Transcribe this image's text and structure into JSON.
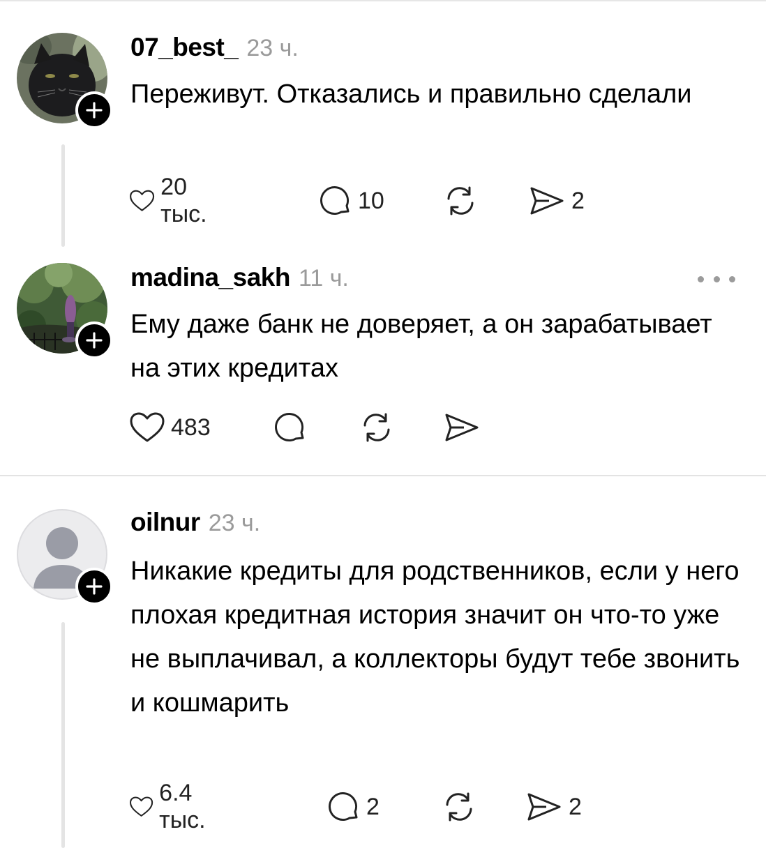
{
  "posts": [
    {
      "username": "07_best_",
      "time": "23 ч.",
      "text": "Переживут. Отказались и правильно сделали",
      "likes": "20 тыс.",
      "replies": "10",
      "reposts": "",
      "shares": "2",
      "avatar": "black-cat-photo"
    },
    {
      "username": "madina_sakh",
      "time": "11 ч.",
      "text": "Ему даже банк не доверяет, а он зарабатывает на этих кредитах",
      "likes": "483",
      "replies": "",
      "reposts": "",
      "shares": "",
      "avatar": "garden-photo"
    },
    {
      "username": "oilnur",
      "time": "23 ч.",
      "text": "Никакие кредиты для родственников, если у него плохая кредитная история значит он что-то уже не выплачивал, а коллекторы будут тебе звонить и кошмарить",
      "likes": "6.4 тыс.",
      "replies": "2",
      "reposts": "",
      "shares": "2",
      "avatar": "default-person"
    }
  ],
  "colors": {
    "text": "#000000",
    "muted": "#9a9a9a",
    "divider": "#e4e4e4",
    "badge": "#000000"
  }
}
